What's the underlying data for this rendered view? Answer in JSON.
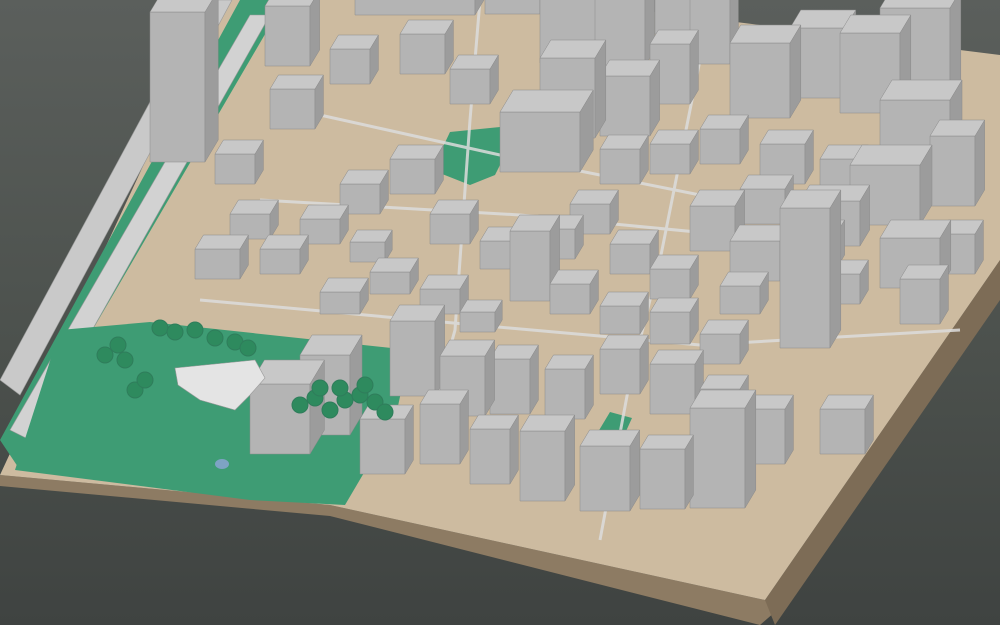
{
  "scene": {
    "kind": "3d-city-block-model",
    "colors": {
      "background": "#4e524f",
      "ground_top": "#cdbba0",
      "ground_side": "#8d7b63",
      "park": "#3e9c74",
      "park_dark": "#2f7d5b",
      "tree": "#2e8a5e",
      "building_top": "#c8c8c8",
      "building_left": "#b4b4b4",
      "building_right": "#9c9c9c",
      "road": "#d9d9d9",
      "water": "#7ea3c4"
    }
  }
}
